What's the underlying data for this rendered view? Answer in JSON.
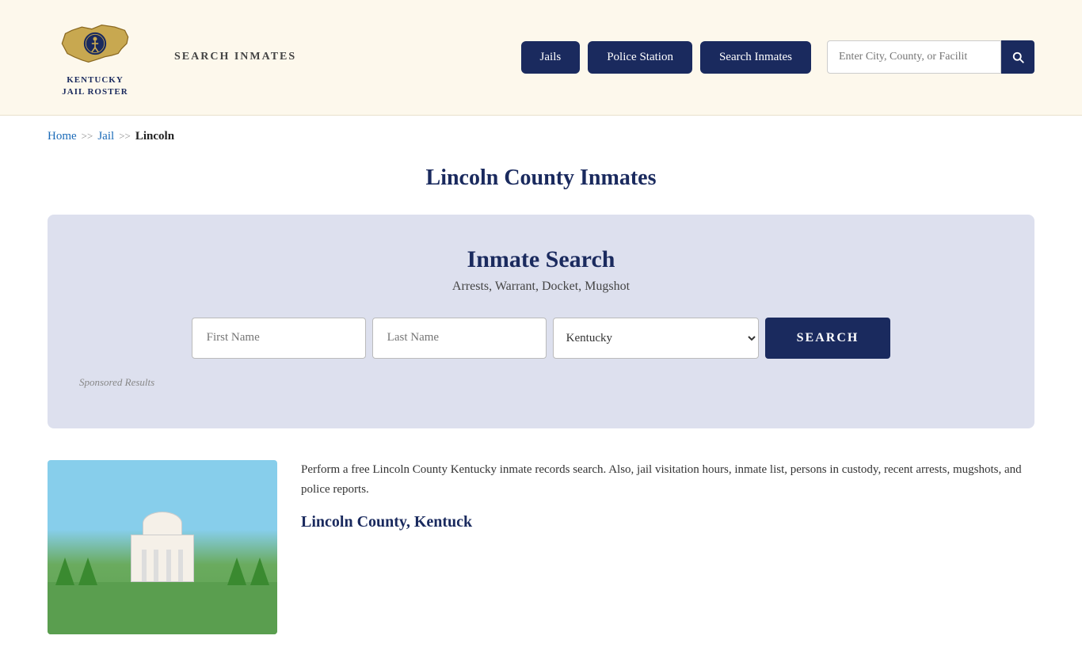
{
  "header": {
    "logo_line1": "KENTUCKY",
    "logo_line2": "JAIL ROSTER",
    "search_inmates_label": "SEARCH INMATES",
    "nav": {
      "jails": "Jails",
      "police_station": "Police Station",
      "search_inmates": "Search Inmates"
    },
    "search_placeholder": "Enter City, County, or Facilit"
  },
  "breadcrumb": {
    "home": "Home",
    "sep1": ">>",
    "jail": "Jail",
    "sep2": ">>",
    "current": "Lincoln"
  },
  "page": {
    "title": "Lincoln County Inmates"
  },
  "inmate_search": {
    "title": "Inmate Search",
    "subtitle": "Arrests, Warrant, Docket, Mugshot",
    "first_name_placeholder": "First Name",
    "last_name_placeholder": "Last Name",
    "state_default": "Kentucky",
    "search_button": "SEARCH",
    "sponsored_label": "Sponsored Results"
  },
  "content": {
    "description": "Perform a free Lincoln County Kentucky inmate records search. Also, jail visitation hours, inmate list, persons in custody, recent arrests, mugshots, and police reports.",
    "subheading": "Lincoln County, Kentuck"
  }
}
